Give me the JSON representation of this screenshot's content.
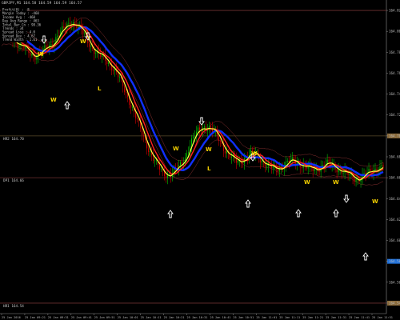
{
  "window": {
    "title": "GBPJPY,M1 164.58 164.59 164.59 164.57"
  },
  "info_panel": {
    "lines": [
      "Profit(0) : -8",
      "Margin Today : -460",
      "Income Avg : -460",
      "Day Avg Range : 463",
      "Total Bar Cn : 98.36",
      "Trends : 34",
      "Spread Lose : 4.0",
      "Spread Dev : 4.67",
      "Trend Width : 1.61"
    ]
  },
  "levels": [
    {
      "name": "top",
      "price": 164.82,
      "label": ""
    },
    {
      "name": "r2",
      "price": 164.7,
      "label": "HR2  164.70"
    },
    {
      "name": "d1",
      "price": 164.66,
      "label": "DP1  164.66"
    },
    {
      "name": "bottom",
      "price": 164.54,
      "label": "HR1  164.54"
    }
  ],
  "price_axis": {
    "ticks": [
      "164.82",
      "164.80",
      "164.78",
      "164.76",
      "164.74",
      "164.72",
      "164.70",
      "164.68",
      "164.66",
      "164.64",
      "164.62",
      "164.60",
      "164.58",
      "164.56",
      "164.54"
    ],
    "highlighted": [
      {
        "value": "164.70",
        "color": "#8a6a3a"
      },
      {
        "value": "164.58",
        "color": "#1e6fd9"
      },
      {
        "value": "164.54",
        "color": "#8a6a3a"
      }
    ]
  },
  "time_axis": {
    "labels": [
      "25 Jan 2016",
      "25 Jan 09:21",
      "25 Jan 09:31",
      "25 Jan 09:41",
      "25 Jan 09:51",
      "25 Jan 10:01",
      "25 Jan 10:11",
      "25 Jan 10:21",
      "25 Jan 10:31",
      "25 Jan 10:41",
      "25 Jan 10:51",
      "25 Jan 11:01",
      "25 Jan 11:11",
      "25 Jan 11:21",
      "25 Jan 11:31",
      "25 Jan 11:41",
      "25 Jan 11:51"
    ]
  },
  "markers": {
    "W": [
      "W",
      "W",
      "W",
      "W",
      "W",
      "W",
      "W",
      "W",
      "W"
    ],
    "L": [
      "L",
      "L"
    ]
  },
  "colors": {
    "background": "#000000",
    "candle_up": "#00c000",
    "candle_down": "#d00000",
    "ma_fast": "#ffff40",
    "ma_mid": "#ff2020",
    "ma_slow": "#1030ff",
    "band": "#8a3030",
    "level_line": "#6e3232",
    "level_line_mid": "#5a4a2a",
    "arrow": "#ffffff",
    "text": "#c8c8c8"
  },
  "chart_data": {
    "type": "candlestick",
    "symbol": "GBPJPY",
    "timeframe": "M1",
    "ylim": [
      164.53,
      164.83
    ],
    "close_path": [
      164.795,
      164.796,
      164.794,
      164.79,
      164.787,
      164.783,
      164.779,
      164.777,
      164.779,
      164.782,
      164.785,
      164.79,
      164.797,
      164.801,
      164.806,
      164.809,
      164.806,
      164.8,
      164.793,
      164.786,
      164.78,
      164.776,
      164.773,
      164.769,
      164.763,
      164.755,
      164.745,
      164.735,
      164.724,
      164.712,
      164.7,
      164.69,
      164.68,
      164.672,
      164.666,
      164.663,
      164.664,
      164.667,
      164.672,
      164.68,
      164.692,
      164.7,
      164.706,
      164.709,
      164.708,
      164.704,
      164.698,
      164.69,
      164.683,
      164.678,
      164.675,
      164.677,
      164.68,
      164.683,
      164.682,
      164.678,
      164.673,
      164.67,
      164.668,
      164.67,
      164.672,
      164.675,
      164.676,
      164.674,
      164.672,
      164.669,
      164.668,
      164.669,
      164.671,
      164.673,
      164.672,
      164.67,
      164.667,
      164.664,
      164.662,
      164.66,
      164.659,
      164.662,
      164.665,
      164.668,
      164.669,
      164.67
    ],
    "series": [
      {
        "name": "fast MA",
        "color": "#ffff40"
      },
      {
        "name": "mid MA",
        "color": "#ff2020"
      },
      {
        "name": "slow MA",
        "color": "#1030ff"
      }
    ]
  }
}
